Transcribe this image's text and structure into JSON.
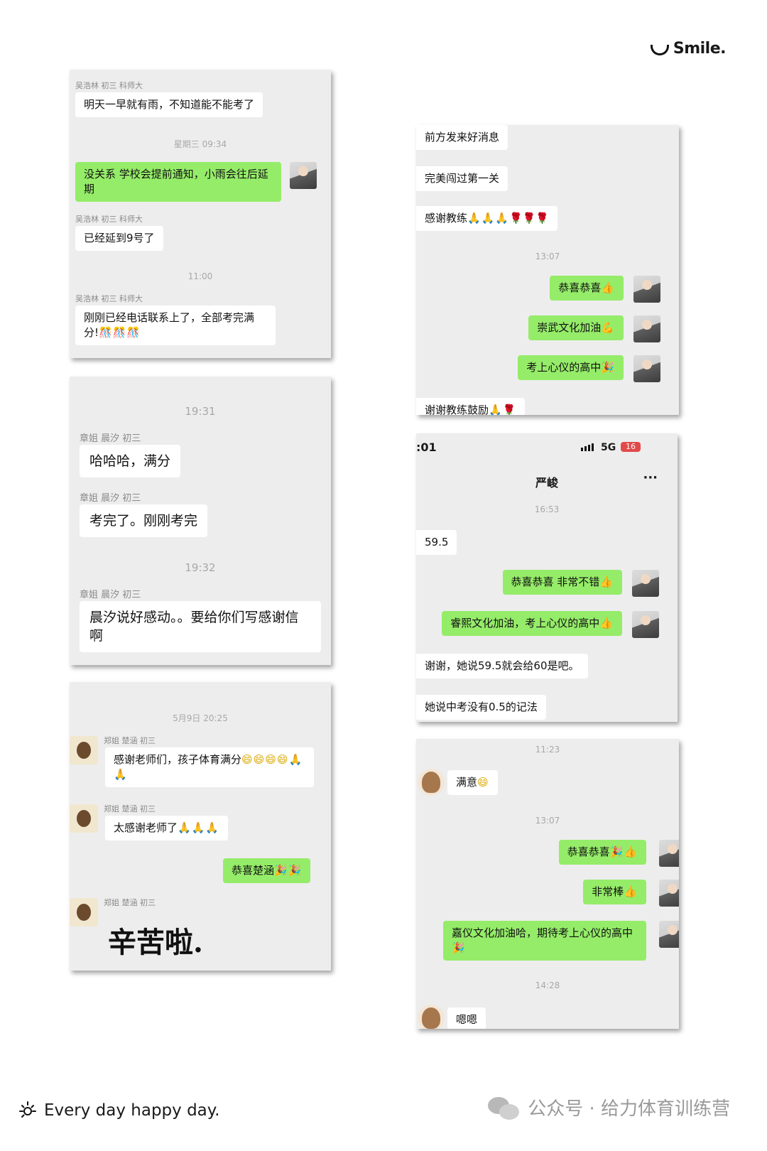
{
  "brand": {
    "name": "Smile."
  },
  "footer": {
    "tagline": "Every day happy day.",
    "account": "公众号 · 给力体育训练营"
  },
  "c1": {
    "n1": "吴浩林 初三 科师大",
    "m1": "明天一早就有雨，不知道能不能考了",
    "t1": "星期三 09:34",
    "m2": "没关系 学校会提前通知，小雨会往后延期",
    "n2": "吴浩林 初三 科师大",
    "m3": "已经延到9号了",
    "t2": "11:00",
    "n3": "吴浩林 初三 科师大",
    "m4": "刚刚已经电话联系上了，全部考完满分!",
    "m4e": "🎊🎊🎊"
  },
  "c2": {
    "t1": "19:31",
    "n1": "章姐 晨汐 初三",
    "m1": "哈哈哈，满分",
    "n2": "章姐 晨汐 初三",
    "m2": "考完了。刚刚考完",
    "t2": "19:32",
    "n3": "章姐 晨汐 初三",
    "m3": "晨汐说好感动。。要给你们写感谢信啊"
  },
  "c3": {
    "t1": "5月9日 20:25",
    "n1": "郑姐 楚涵 初三",
    "m1": "感谢老师们，孩子体育满分",
    "m1e": "😄😄😄😄🙏🙏",
    "n2": "郑姐 楚涵 初三",
    "m2": "太感谢老师了",
    "m2e": "🙏🙏🙏",
    "m3": "恭喜楚涵",
    "m3e": "🎉🎉",
    "n3": "郑姐 楚涵 初三",
    "m4": "辛苦啦."
  },
  "c4": {
    "m1": "前方发来好消息",
    "m2": "完美闯过第一关",
    "m3": "感谢教练",
    "m3e": "🙏🙏🙏",
    "m3r": "🌹🌹🌹",
    "t1": "13:07",
    "m4": "恭喜恭喜",
    "m4e": "👍",
    "m5": "崇武文化加油",
    "m5e": "💪",
    "m6": "考上心仪的高中",
    "m6e": "🎉",
    "m7": "谢谢教练鼓励",
    "m7e": "🙏🌹"
  },
  "c5": {
    "clock": ":01",
    "signal": "5G",
    "battery": "16",
    "contact": "严峻",
    "more": "···",
    "t1": "16:53",
    "m1": "59.5",
    "m2": "恭喜恭喜 非常不错",
    "m2e": "👍",
    "m3": "睿熙文化加油，考上心仪的高中",
    "m3e": "👍",
    "m4": "谢谢，她说59.5就会给60是吧。",
    "m5": "她说中考没有0.5的记法"
  },
  "c6": {
    "t1": "11:23",
    "m1": "满意",
    "m1e": "😄",
    "t2": "13:07",
    "m2": "恭喜恭喜",
    "m2e": "🎉👍",
    "m3": "非常棒",
    "m3e": "👍",
    "m4": "嘉仪文化加油哈，期待考上心仪的高中",
    "m4e": "🎉",
    "t3": "14:28",
    "m5": "嗯嗯"
  }
}
